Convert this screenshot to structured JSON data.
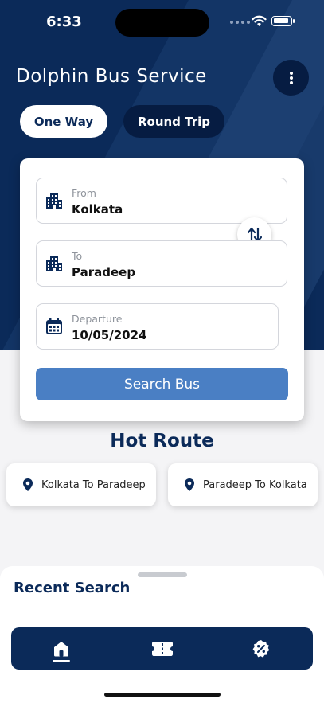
{
  "status_bar": {
    "time": "6:33"
  },
  "header": {
    "title": "Dolphin Bus Service",
    "menu_icon": "more-vertical-icon"
  },
  "trip_type": {
    "options": [
      "One Way",
      "Round Trip"
    ],
    "selected": "One Way"
  },
  "search_form": {
    "from": {
      "label": "From",
      "value": "Kolkata",
      "icon": "building-icon"
    },
    "to": {
      "label": "To",
      "value": "Paradeep",
      "icon": "building-icon"
    },
    "departure": {
      "label": "Departure",
      "value": "10/05/2024",
      "icon": "calendar-icon"
    },
    "swap_icon": "swap-vertical-icon",
    "search_button": "Search Bus"
  },
  "hot_route": {
    "title": "Hot Route",
    "routes": [
      "Kolkata To Paradeep",
      "Paradeep To Kolkata"
    ]
  },
  "recent_search": {
    "title": "Recent Search"
  },
  "tab_bar": {
    "items": [
      "home-icon",
      "ticket-icon",
      "discount-icon"
    ],
    "active": "home-icon"
  },
  "colors": {
    "primary": "#0b2a59",
    "accent": "#4a7fc4",
    "background": "#f4f4f6"
  }
}
